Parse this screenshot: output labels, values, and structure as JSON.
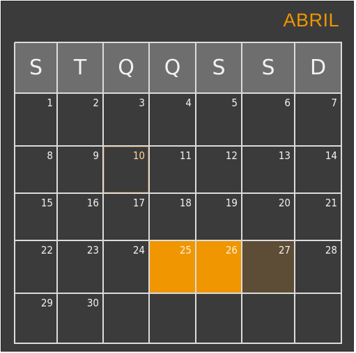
{
  "calendar": {
    "month": "ABRIL",
    "weekdays": [
      "S",
      "T",
      "Q",
      "Q",
      "S",
      "S",
      "D"
    ],
    "weeks": [
      [
        "1",
        "2",
        "3",
        "4",
        "5",
        "6",
        "7"
      ],
      [
        "8",
        "9",
        "10",
        "11",
        "12",
        "13",
        "14"
      ],
      [
        "15",
        "16",
        "17",
        "18",
        "19",
        "20",
        "21"
      ],
      [
        "22",
        "23",
        "24",
        "25",
        "26",
        "27",
        "28"
      ],
      [
        "29",
        "30",
        "",
        "",
        "",
        "",
        ""
      ]
    ],
    "today": "10",
    "highlighted": [
      {
        "day": "25",
        "color": "#ef9600"
      },
      {
        "day": "26",
        "color": "#ef9600"
      },
      {
        "day": "27",
        "color": "#5d4d36"
      }
    ],
    "colors": {
      "accent": "#ef9600",
      "background": "#3b3b3b",
      "header": "#6e6e6e",
      "grid": "#dcdcdc",
      "muted_highlight": "#5d4d36"
    }
  }
}
